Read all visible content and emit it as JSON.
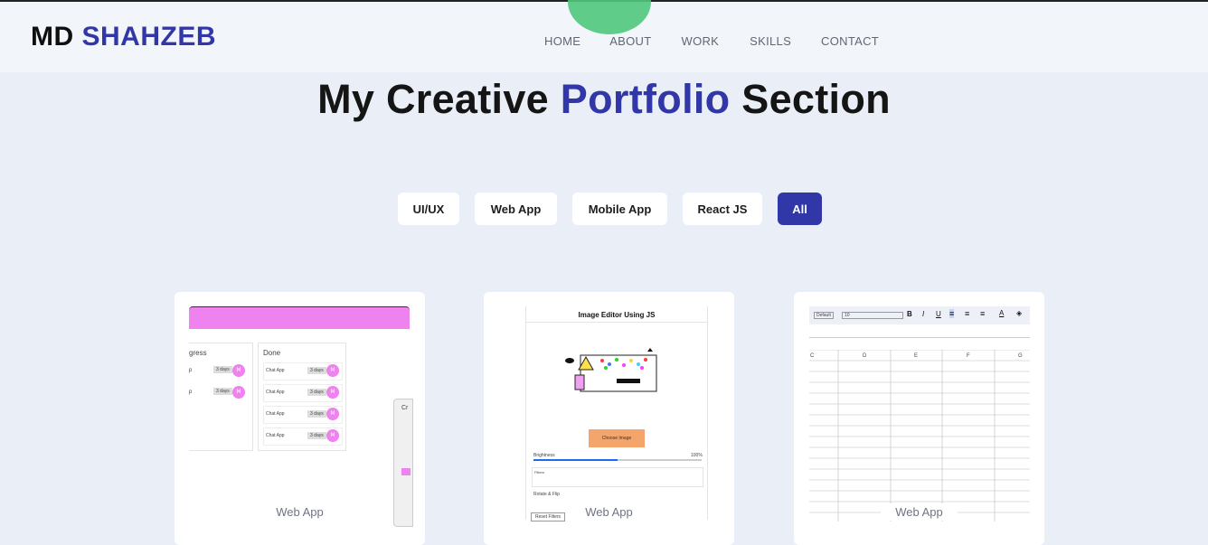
{
  "logo": {
    "first": "MD",
    "second": "SHAHZEB"
  },
  "nav": {
    "items": [
      "HOME",
      "ABOUT",
      "WORK",
      "SKILLS",
      "CONTACT"
    ]
  },
  "hero": {
    "title_part1": "My Creative",
    "title_highlight": "Portfolio",
    "title_part2": "Section"
  },
  "filters": {
    "items": [
      "UI/UX",
      "Web App",
      "Mobile App",
      "React JS",
      "All"
    ],
    "active": "All"
  },
  "cards": [
    {
      "category": "Web App"
    },
    {
      "category": "Web App"
    },
    {
      "category": "Web App"
    }
  ],
  "card1_preview": {
    "col1_header": "gress",
    "col2_header": "Done",
    "task": "Chat App",
    "badge": "3 days",
    "avatar": "M",
    "side_header": "Cr"
  },
  "card2_preview": {
    "title": "Image Editor Using JS",
    "button": "Choose Image",
    "slider_label": "Brightness",
    "slider_value": "100%",
    "filters_label": "Filters",
    "rotate_label": "Rotate & Flip",
    "reset": "Reset Filters"
  },
  "card3_preview": {
    "font_select": "Default",
    "size": "10",
    "cols": [
      "C",
      "D",
      "E",
      "F",
      "G"
    ]
  },
  "colors": {
    "accent": "#3137a6",
    "bg": "#eaeff7",
    "header_bg": "#f2f5fa",
    "blob": "#4fc87c",
    "pink": "#ee82ee"
  }
}
